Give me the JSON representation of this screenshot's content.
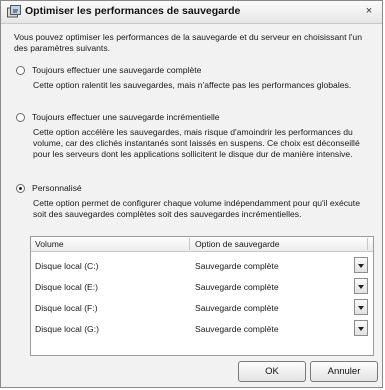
{
  "window": {
    "title": "Optimiser les performances de sauvegarde",
    "close_glyph": "×"
  },
  "intro": "Vous pouvez optimiser les performances de la sauvegarde et du serveur en choisissant l'un des paramètres suivants.",
  "options": [
    {
      "label": "Toujours effectuer une sauvegarde complète",
      "description": "Cette option ralentit les sauvegardes, mais n'affecte pas les performances globales.",
      "checked": false
    },
    {
      "label": "Toujours effectuer une sauvegarde incrémentielle",
      "description": "Cette option accélère les sauvegardes, mais risque d'amoindrir les performances du volume, car des clichés instantanés sont laissés en suspens. Ce choix est déconseillé pour les serveurs dont les applications sollicitent le disque dur de manière intensive.",
      "checked": false
    },
    {
      "label": "Personnalisé",
      "description": "Cette option permet de configurer chaque volume indépendamment pour qu'il exécute soit des sauvegardes complètes soit des sauvegardes incrémentielles.",
      "checked": true
    }
  ],
  "table": {
    "headers": [
      "Volume",
      "Option de sauvegarde"
    ],
    "rows": [
      {
        "volume": "Disque local (C:)",
        "option": "Sauvegarde complète"
      },
      {
        "volume": "Disque local (E:)",
        "option": "Sauvegarde complète"
      },
      {
        "volume": "Disque local (F:)",
        "option": "Sauvegarde complète"
      },
      {
        "volume": "Disque local (G:)",
        "option": "Sauvegarde complète"
      }
    ]
  },
  "buttons": {
    "ok": "OK",
    "cancel": "Annuler"
  },
  "icons": {
    "title": "backup-icon",
    "close": "close-icon",
    "dropdown": "chevron-down-icon"
  },
  "colors": {
    "window_bg": "#f2f2f2",
    "table_bg": "#ffffff",
    "border": "#8a8a8a"
  }
}
